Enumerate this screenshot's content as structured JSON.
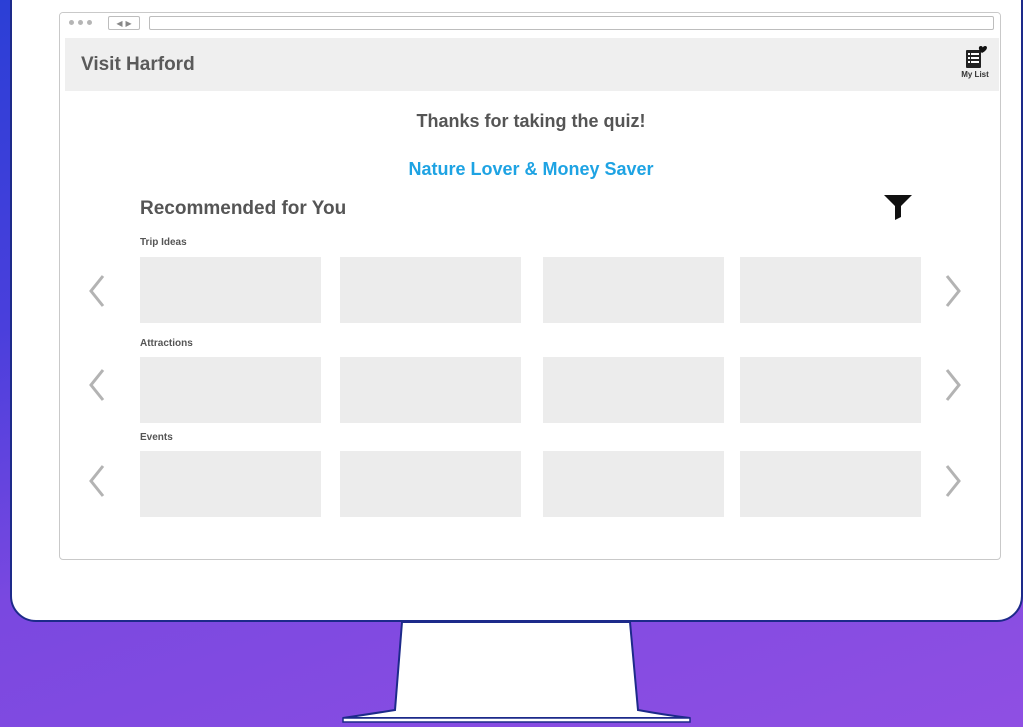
{
  "header": {
    "site_title": "Visit Harford",
    "my_list_label": "My List"
  },
  "main": {
    "thanks_text": "Thanks for taking the quiz!",
    "persona_text": "Nature Lover & Money Saver",
    "recommended_title": "Recommended for You"
  },
  "sections": [
    {
      "label": "Trip Ideas"
    },
    {
      "label": "Attractions"
    },
    {
      "label": "Events"
    }
  ],
  "colors": {
    "accent": "#1ea3e3",
    "tile": "#ececec",
    "header_bg": "#efefef"
  }
}
